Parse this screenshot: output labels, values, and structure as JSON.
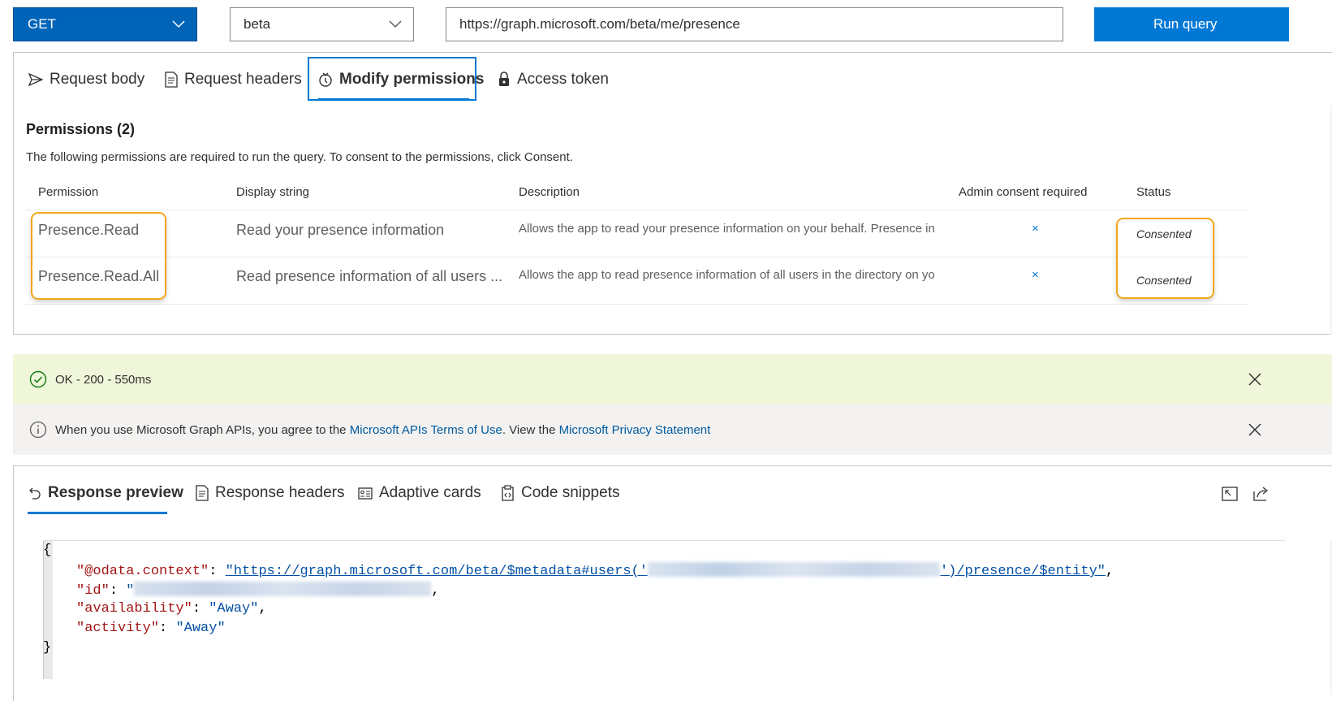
{
  "query": {
    "method": "GET",
    "version": "beta",
    "url": "https://graph.microsoft.com/beta/me/presence",
    "run_label": "Run query"
  },
  "request_tabs": [
    {
      "label": "Request body",
      "icon": "send-icon"
    },
    {
      "label": "Request headers",
      "icon": "document-icon"
    },
    {
      "label": "Modify permissions",
      "icon": "shield-icon",
      "active": true
    },
    {
      "label": "Access token",
      "icon": "lock-icon"
    }
  ],
  "permissions": {
    "title": "Permissions (2)",
    "description": "The following permissions are required to run the query. To consent to the permissions, click Consent.",
    "columns": [
      "Permission",
      "Display string",
      "Description",
      "Admin consent required",
      "Status"
    ],
    "rows": [
      {
        "permission": "Presence.Read",
        "display": "Read your presence information",
        "description": "Allows the app to read your presence information on your behalf. Presence in",
        "admin": "×",
        "status": "Consented"
      },
      {
        "permission": "Presence.Read.All",
        "display": "Read presence information of all users ...",
        "description": "Allows the app to read presence information of all users in the directory on yo",
        "admin": "×",
        "status": "Consented"
      }
    ]
  },
  "status_bar": {
    "text": "OK - 200 - 550ms",
    "icon": "check-circle-icon"
  },
  "info_bar": {
    "prefix": "When you use Microsoft Graph APIs, you agree to the ",
    "link1": "Microsoft APIs Terms of Use",
    "middle": ". View the ",
    "link2": "Microsoft Privacy Statement",
    "icon": "info-icon"
  },
  "response_tabs": [
    {
      "label": "Response preview",
      "icon": "undo-icon",
      "active": true
    },
    {
      "label": "Response headers",
      "icon": "document-icon"
    },
    {
      "label": "Adaptive cards",
      "icon": "card-icon"
    },
    {
      "label": "Code snippets",
      "icon": "clipboard-code-icon"
    }
  ],
  "response_json": {
    "open": "{",
    "close": "}",
    "context_key": "\"@odata.context\"",
    "context_prefix": "\"https://graph.microsoft.com/beta/$metadata#users('",
    "context_suffix": "')/presence/$entity\"",
    "id_key": "\"id\"",
    "id_value_prefix": "\"",
    "availability_key": "\"availability\"",
    "availability_value": "\"Away\"",
    "activity_key": "\"activity\"",
    "activity_value": "\"Away\""
  },
  "colors": {
    "accent": "#0078d4",
    "method_bg": "#0064b8",
    "highlight": "#f2a61a",
    "success_bg": "#eff6da",
    "info_bg": "#f3f2f1"
  }
}
